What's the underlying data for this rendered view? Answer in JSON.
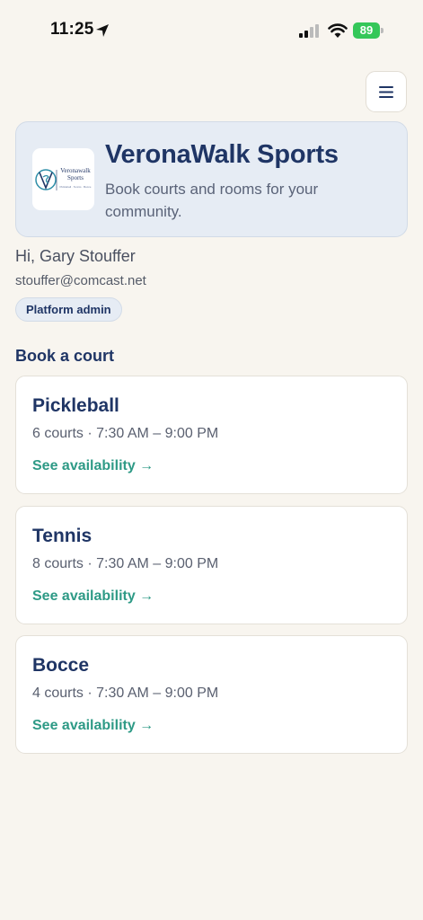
{
  "status_bar": {
    "time": "11:25",
    "battery": "89"
  },
  "brand": {
    "title": "VeronaWalk Sports",
    "subtitle": "Book courts and rooms for your community.",
    "logo_line1": "Veronawalk",
    "logo_line2": "Sports",
    "logo_tagline": "Pickleball · Tennis · Bocce"
  },
  "user": {
    "greeting": "Hi, Gary Stouffer",
    "email": "stouffer@comcast.net",
    "role": "Platform admin"
  },
  "section_title": "Book a court",
  "courts": [
    {
      "name": "Pickleball",
      "details": "6 courts · 7:30 AM – 9:00 PM",
      "link": "See availability →"
    },
    {
      "name": "Tennis",
      "details": "8 courts · 7:30 AM – 9:00 PM",
      "link": "See availability →"
    },
    {
      "name": "Bocce",
      "details": "4 courts · 7:30 AM – 9:00 PM",
      "link": "See availability →"
    }
  ],
  "colors": {
    "accent": "#2e9a86",
    "brand": "#1f3565",
    "background": "#f8f5ef"
  }
}
